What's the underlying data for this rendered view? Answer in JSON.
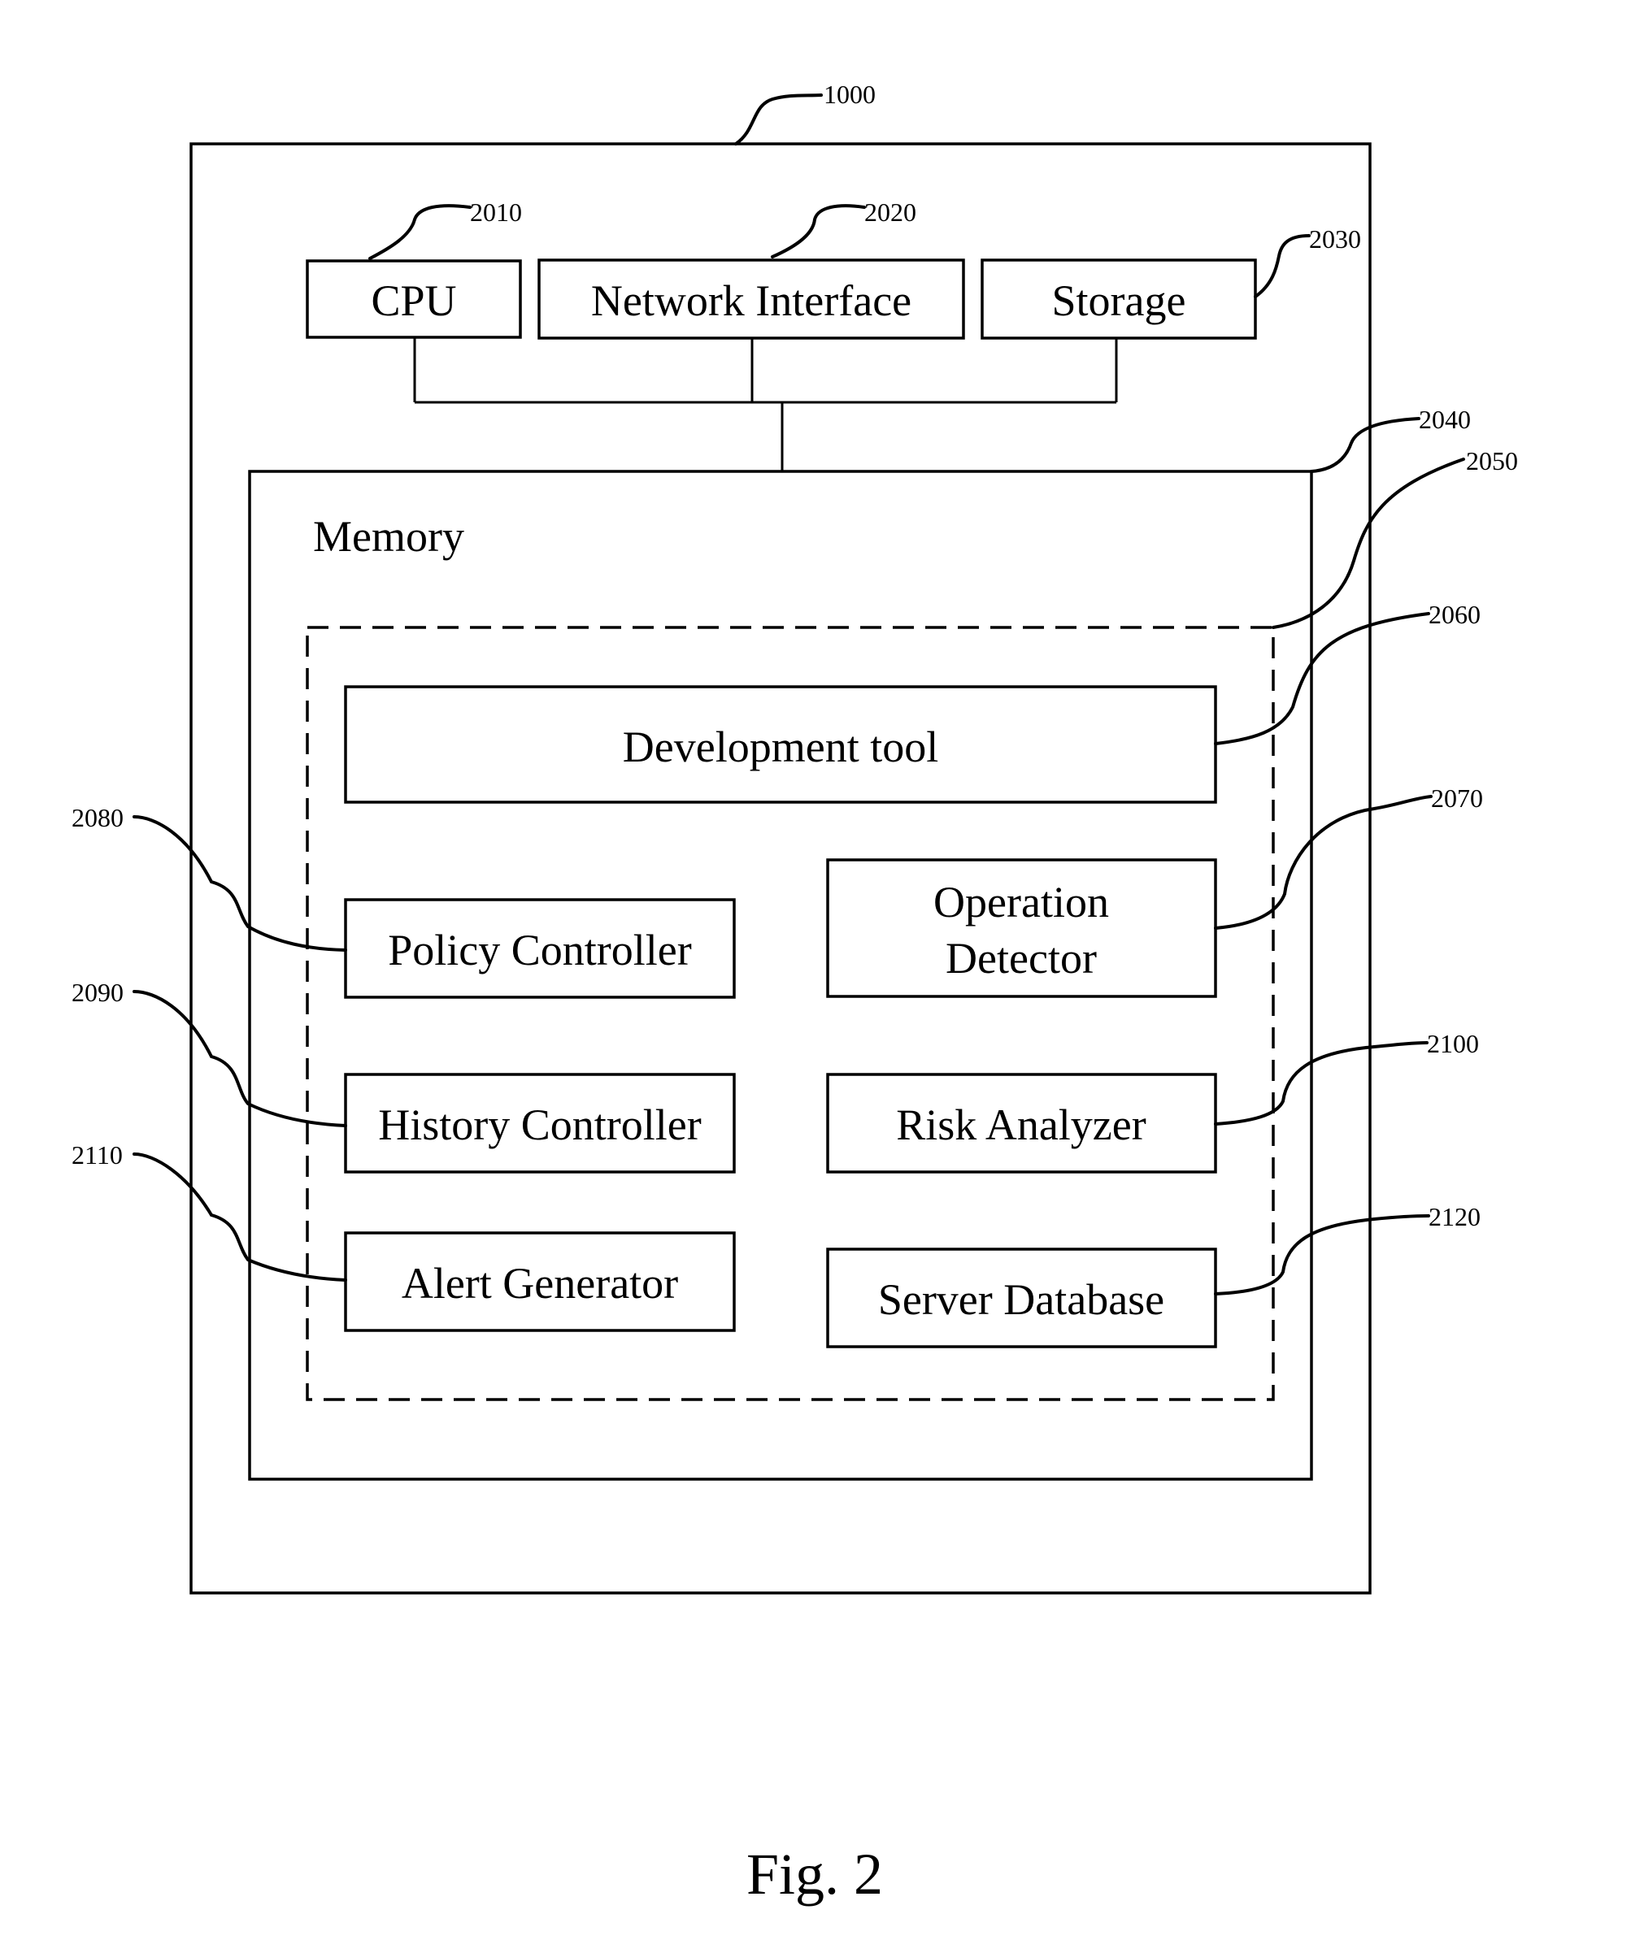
{
  "figure": {
    "caption": "Fig. 2",
    "system_ref": "1000"
  },
  "hardware": {
    "cpu": {
      "label": "CPU",
      "ref": "2010"
    },
    "network_interface": {
      "label": "Network Interface",
      "ref": "2020"
    },
    "storage": {
      "label": "Storage",
      "ref": "2030"
    }
  },
  "memory": {
    "label": "Memory",
    "ref": "2040",
    "program_ref": "2050",
    "modules": {
      "development_tool": {
        "label": "Development tool",
        "ref": "2060"
      },
      "operation_detector": {
        "label_line1": "Operation",
        "label_line2": "Detector",
        "ref": "2070"
      },
      "policy_controller": {
        "label": "Policy Controller",
        "ref": "2080"
      },
      "history_controller": {
        "label": "History Controller",
        "ref": "2090"
      },
      "risk_analyzer": {
        "label": "Risk Analyzer",
        "ref": "2100"
      },
      "alert_generator": {
        "label": "Alert Generator",
        "ref": "2110"
      },
      "server_database": {
        "label": "Server Database",
        "ref": "2120"
      }
    }
  }
}
